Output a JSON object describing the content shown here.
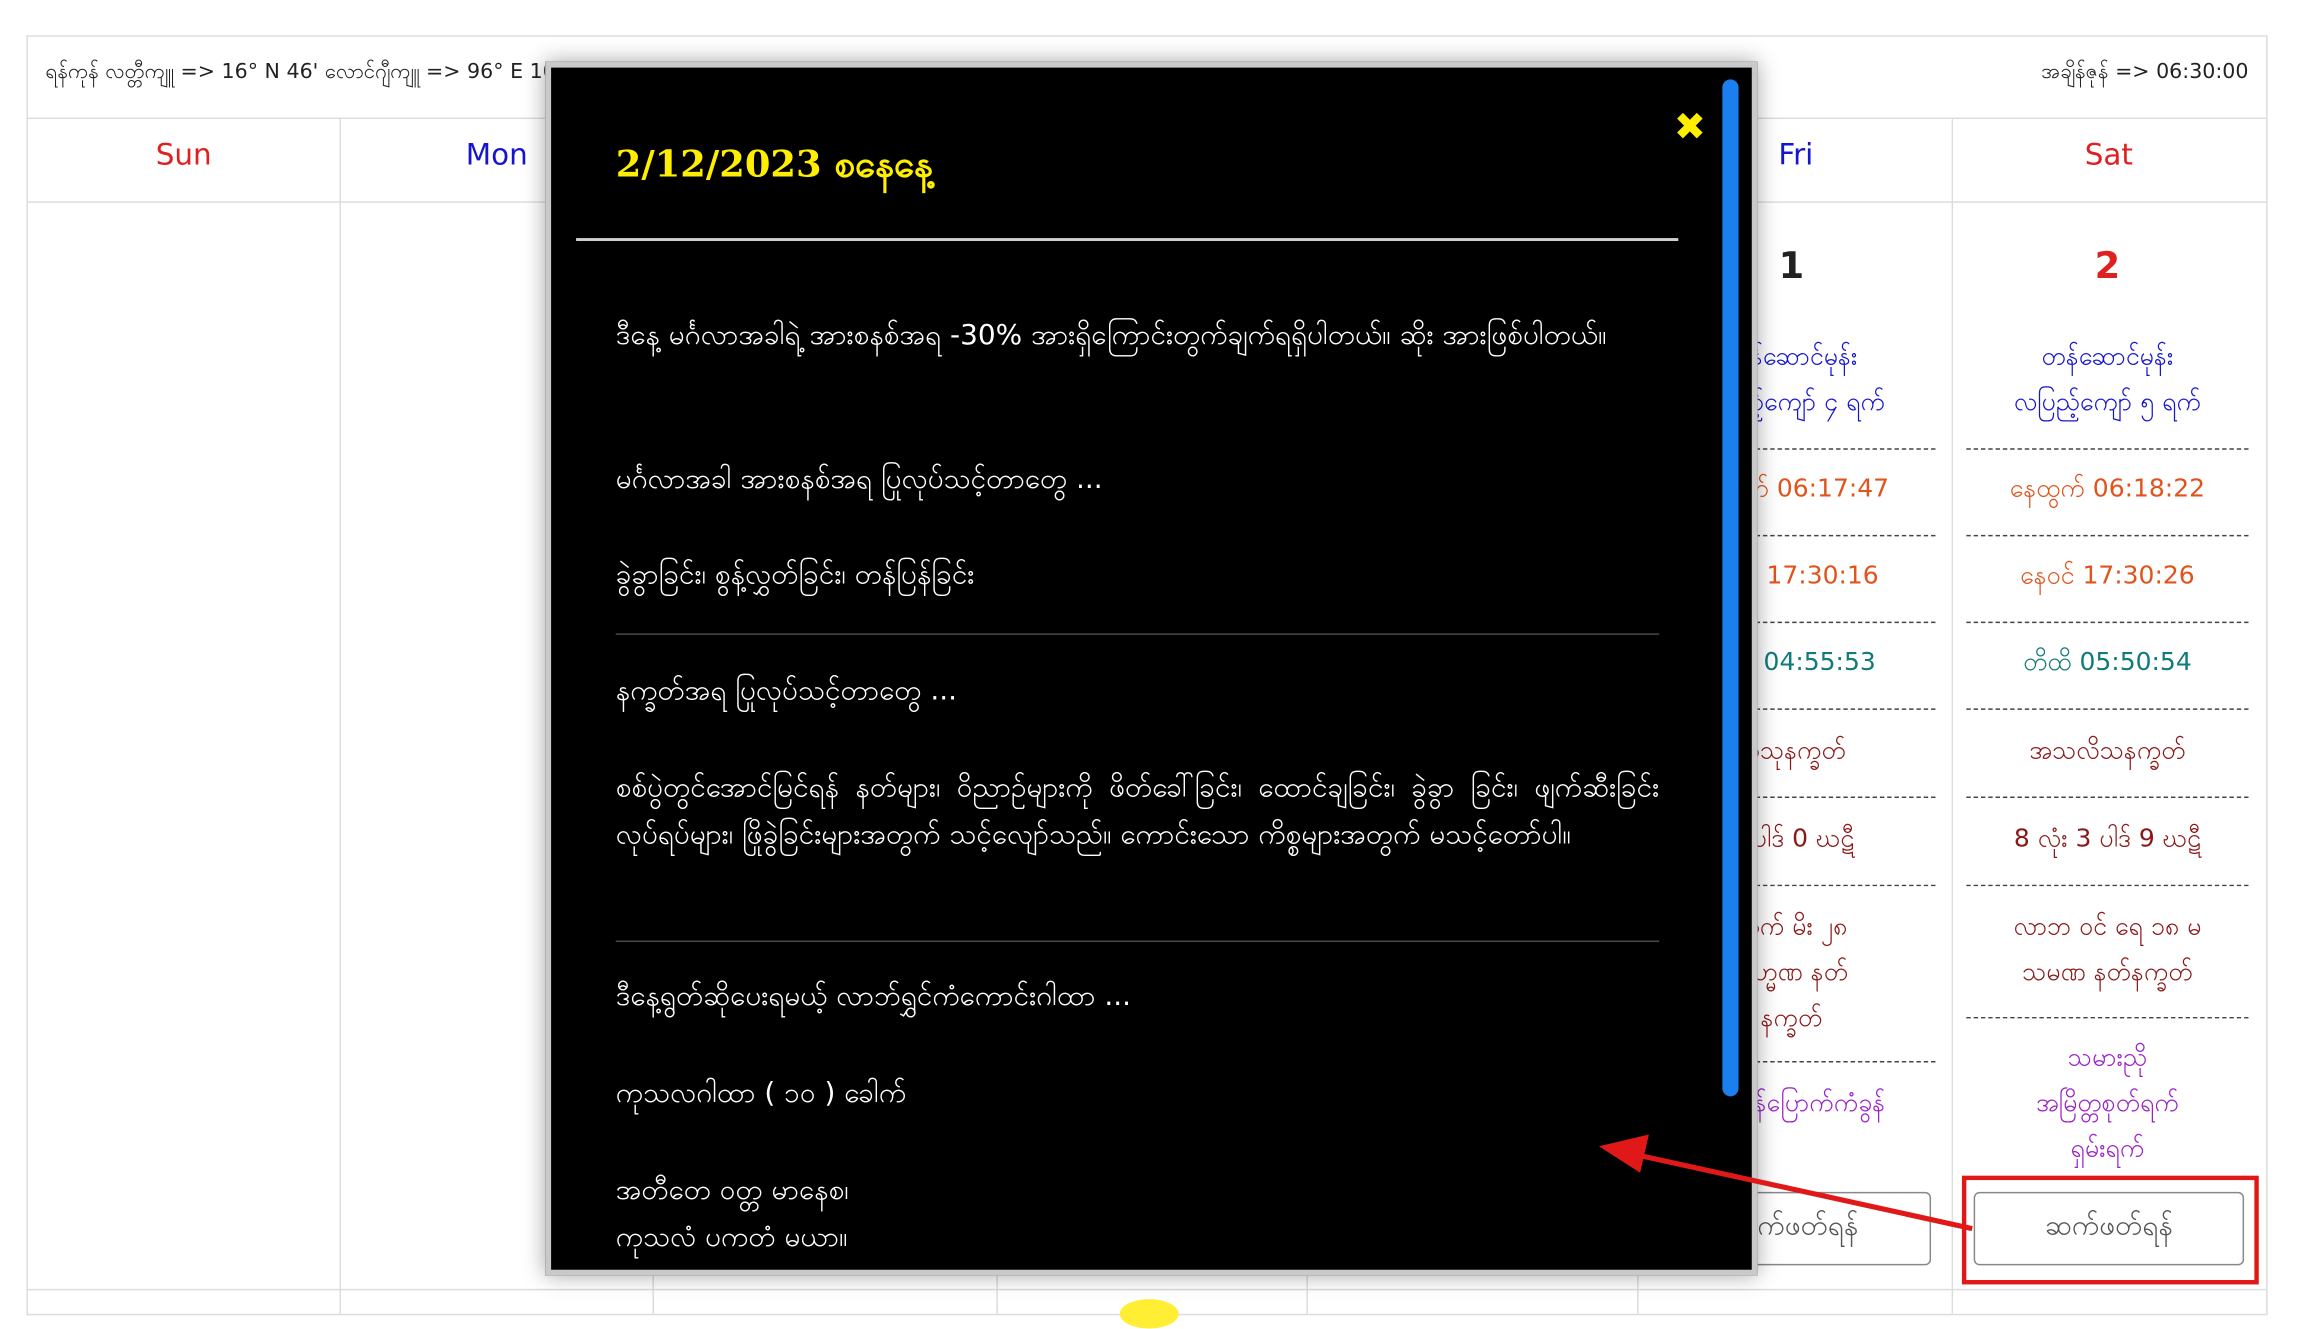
{
  "header": {
    "location": "ရန်ကုန် လတ္တီကျူ => 16° N 46' လောင်ဂျီကျူ => 96° E 10'",
    "timezone": "အချိန်ဇုန် => 06:30:00"
  },
  "days": {
    "sun": "Sun",
    "mon": "Mon",
    "fri": "Fri",
    "sat": "Sat"
  },
  "cells": {
    "fri": {
      "date": "1",
      "month": [
        "တန်ဆောင်မုန်း",
        "လပြည့်ကျော် ၄ ရက်"
      ],
      "sunrise": "နေထွက် 06:17:47",
      "sunset": "နေဝင် 17:30:16",
      "tithi": "တိထိ 04:55:53",
      "nakshatra": "အသုနက္ခတ်",
      "ghati": "0 ပါဒ် 0 ဃဋီ",
      "lagna": [
        "ထွက် မိး ၂၈",
        "ပြဟ္မဏ နတ်",
        "နက္ခတ်"
      ],
      "extra": [
        "ပြက္ခဒိန်ပြောက်ကံခွန်"
      ],
      "button": "ဆက်ဖတ်ရန်"
    },
    "sat": {
      "date": "2",
      "month": [
        "တန်ဆောင်မုန်း",
        "လပြည့်ကျော် ၅ ရက်"
      ],
      "sunrise": "နေထွက် 06:18:22",
      "sunset": "နေဝင် 17:30:26",
      "tithi": "တိထိ 05:50:54",
      "nakshatra": "အသလိသနက္ခတ်",
      "ghati": "8 လုံး 3 ပါဒ် 9 ဃဋီ",
      "lagna": [
        "လာဘ ဝင် ရေ ၁၈ မ",
        "သမဏ နတ်နက္ခတ်"
      ],
      "extra": [
        "သမားညို",
        "အမြိတ္တစုတ်ရက်",
        "ရှမ်းရက်"
      ],
      "button": "ဆက်ဖတ်ရန်"
    }
  },
  "modal": {
    "title": "2/12/2023 စနေနေ့",
    "close": "✖",
    "p1": "ဒီနေ့ မင်္ဂလာအခါရဲ့ အားစနစ်အရ -30% အားရှိကြောင်းတွက်ချက်ရရှိပါတယ်။ ဆိုး အားဖြစ်ပါတယ်။",
    "h1": "မင်္ဂလာအခါ အားစနစ်အရ ပြုလုပ်သင့်တာတွေ ...",
    "p2": "ခွဲခွာခြင်း၊ စွန့်လွှတ်ခြင်း၊ တန်ပြန်ခြင်း",
    "h2": "နက္ခတ်အရ ပြုလုပ်သင့်တာတွေ ...",
    "p3": "စစ်ပွဲတွင်အောင်မြင်ရန် နတ်များ၊ ဝိညာဉ်များကို ဖိတ်ခေါ်ခြင်း၊ ထောင်ချခြင်း၊ ခွဲခွာ ခြင်း၊ ဖျက်ဆီးခြင်းလုပ်ရပ်များ၊ ဖြိုခွဲခြင်းများအတွက် သင့်လျော်သည်။ ကောင်းသော ကိစ္စများအတွက် မသင့်တော်ပါ။",
    "h3": "ဒီနေ့ရွတ်ဆိုပေးရမယ့် လာဘ်ရွှင်ကံကောင်းဂါထာ ...",
    "p4": "ကုသလဂါထာ ( ၁၀ ) ခေါက်",
    "p5": "အတီတေ ဝတ္တ မာနေစ၊",
    "p6": "ကုသလံ ပကတံ မယာ။"
  },
  "colors": {
    "sun": "#e02020",
    "mon": "#1515d0",
    "fri": "#1515d0",
    "sat": "#e02020",
    "month_text": "#1515d0",
    "time_text": "#e0541c",
    "tithi_text": "#117a7a",
    "nakshatra_text": "#8b1818",
    "extra_text": "#9b22c8",
    "modal_title": "#ffee00",
    "annotation": "#e01818"
  }
}
